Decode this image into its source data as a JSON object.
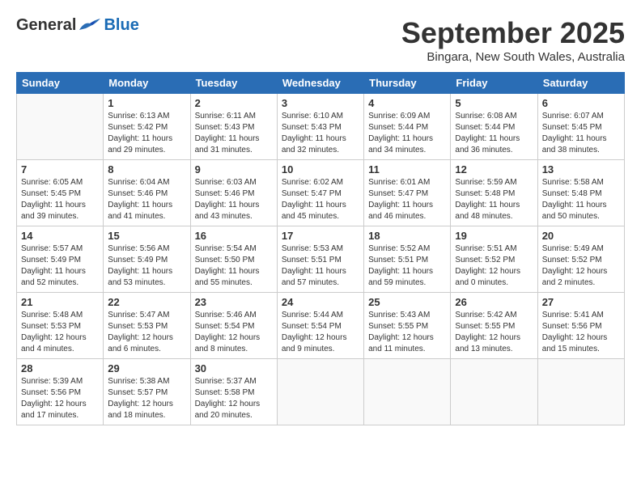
{
  "header": {
    "logo_general": "General",
    "logo_blue": "Blue",
    "month": "September 2025",
    "location": "Bingara, New South Wales, Australia"
  },
  "days_of_week": [
    "Sunday",
    "Monday",
    "Tuesday",
    "Wednesday",
    "Thursday",
    "Friday",
    "Saturday"
  ],
  "weeks": [
    [
      {
        "day": "",
        "info": ""
      },
      {
        "day": "1",
        "info": "Sunrise: 6:13 AM\nSunset: 5:42 PM\nDaylight: 11 hours\nand 29 minutes."
      },
      {
        "day": "2",
        "info": "Sunrise: 6:11 AM\nSunset: 5:43 PM\nDaylight: 11 hours\nand 31 minutes."
      },
      {
        "day": "3",
        "info": "Sunrise: 6:10 AM\nSunset: 5:43 PM\nDaylight: 11 hours\nand 32 minutes."
      },
      {
        "day": "4",
        "info": "Sunrise: 6:09 AM\nSunset: 5:44 PM\nDaylight: 11 hours\nand 34 minutes."
      },
      {
        "day": "5",
        "info": "Sunrise: 6:08 AM\nSunset: 5:44 PM\nDaylight: 11 hours\nand 36 minutes."
      },
      {
        "day": "6",
        "info": "Sunrise: 6:07 AM\nSunset: 5:45 PM\nDaylight: 11 hours\nand 38 minutes."
      }
    ],
    [
      {
        "day": "7",
        "info": "Sunrise: 6:05 AM\nSunset: 5:45 PM\nDaylight: 11 hours\nand 39 minutes."
      },
      {
        "day": "8",
        "info": "Sunrise: 6:04 AM\nSunset: 5:46 PM\nDaylight: 11 hours\nand 41 minutes."
      },
      {
        "day": "9",
        "info": "Sunrise: 6:03 AM\nSunset: 5:46 PM\nDaylight: 11 hours\nand 43 minutes."
      },
      {
        "day": "10",
        "info": "Sunrise: 6:02 AM\nSunset: 5:47 PM\nDaylight: 11 hours\nand 45 minutes."
      },
      {
        "day": "11",
        "info": "Sunrise: 6:01 AM\nSunset: 5:47 PM\nDaylight: 11 hours\nand 46 minutes."
      },
      {
        "day": "12",
        "info": "Sunrise: 5:59 AM\nSunset: 5:48 PM\nDaylight: 11 hours\nand 48 minutes."
      },
      {
        "day": "13",
        "info": "Sunrise: 5:58 AM\nSunset: 5:48 PM\nDaylight: 11 hours\nand 50 minutes."
      }
    ],
    [
      {
        "day": "14",
        "info": "Sunrise: 5:57 AM\nSunset: 5:49 PM\nDaylight: 11 hours\nand 52 minutes."
      },
      {
        "day": "15",
        "info": "Sunrise: 5:56 AM\nSunset: 5:49 PM\nDaylight: 11 hours\nand 53 minutes."
      },
      {
        "day": "16",
        "info": "Sunrise: 5:54 AM\nSunset: 5:50 PM\nDaylight: 11 hours\nand 55 minutes."
      },
      {
        "day": "17",
        "info": "Sunrise: 5:53 AM\nSunset: 5:51 PM\nDaylight: 11 hours\nand 57 minutes."
      },
      {
        "day": "18",
        "info": "Sunrise: 5:52 AM\nSunset: 5:51 PM\nDaylight: 11 hours\nand 59 minutes."
      },
      {
        "day": "19",
        "info": "Sunrise: 5:51 AM\nSunset: 5:52 PM\nDaylight: 12 hours\nand 0 minutes."
      },
      {
        "day": "20",
        "info": "Sunrise: 5:49 AM\nSunset: 5:52 PM\nDaylight: 12 hours\nand 2 minutes."
      }
    ],
    [
      {
        "day": "21",
        "info": "Sunrise: 5:48 AM\nSunset: 5:53 PM\nDaylight: 12 hours\nand 4 minutes."
      },
      {
        "day": "22",
        "info": "Sunrise: 5:47 AM\nSunset: 5:53 PM\nDaylight: 12 hours\nand 6 minutes."
      },
      {
        "day": "23",
        "info": "Sunrise: 5:46 AM\nSunset: 5:54 PM\nDaylight: 12 hours\nand 8 minutes."
      },
      {
        "day": "24",
        "info": "Sunrise: 5:44 AM\nSunset: 5:54 PM\nDaylight: 12 hours\nand 9 minutes."
      },
      {
        "day": "25",
        "info": "Sunrise: 5:43 AM\nSunset: 5:55 PM\nDaylight: 12 hours\nand 11 minutes."
      },
      {
        "day": "26",
        "info": "Sunrise: 5:42 AM\nSunset: 5:55 PM\nDaylight: 12 hours\nand 13 minutes."
      },
      {
        "day": "27",
        "info": "Sunrise: 5:41 AM\nSunset: 5:56 PM\nDaylight: 12 hours\nand 15 minutes."
      }
    ],
    [
      {
        "day": "28",
        "info": "Sunrise: 5:39 AM\nSunset: 5:56 PM\nDaylight: 12 hours\nand 17 minutes."
      },
      {
        "day": "29",
        "info": "Sunrise: 5:38 AM\nSunset: 5:57 PM\nDaylight: 12 hours\nand 18 minutes."
      },
      {
        "day": "30",
        "info": "Sunrise: 5:37 AM\nSunset: 5:58 PM\nDaylight: 12 hours\nand 20 minutes."
      },
      {
        "day": "",
        "info": ""
      },
      {
        "day": "",
        "info": ""
      },
      {
        "day": "",
        "info": ""
      },
      {
        "day": "",
        "info": ""
      }
    ]
  ]
}
